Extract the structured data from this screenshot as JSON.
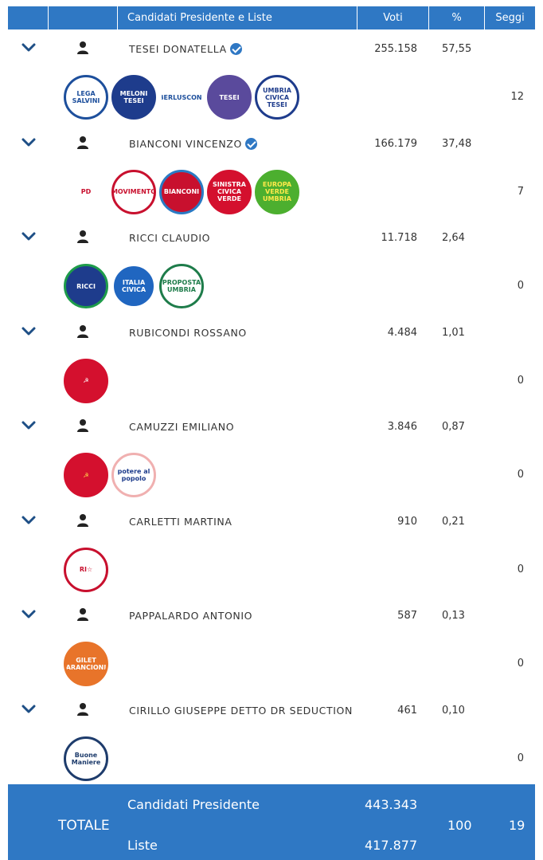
{
  "header": {
    "col_name": "Candidati Presidente e Liste",
    "col_votes": "Voti",
    "col_pct": "%",
    "col_seats": "Seggi"
  },
  "candidates": [
    {
      "name": "TESEI DONATELLA",
      "elected": true,
      "votes": "255.158",
      "pct": "57,55",
      "seats": "12",
      "lists": [
        {
          "icon": "lega-salvini-logo",
          "text": "LEGA SALVINI",
          "bg": "#ffffff",
          "fg": "#1d4f9c",
          "border": "#1d4f9c"
        },
        {
          "icon": "fratelli-italia-logo",
          "text": "MELONI TESEI",
          "bg": "#1e3c8c",
          "fg": "#ffffff",
          "border": "#1e3c8c"
        },
        {
          "icon": "forza-italia-logo",
          "text": "BERLUSCONI",
          "bg": "#ffffff",
          "fg": "#1d4f9c",
          "border": "#ffffff"
        },
        {
          "icon": "tesei-presidente-logo",
          "text": "TESEI",
          "bg": "#5a4a9c",
          "fg": "#ffffff",
          "border": "#5a4a9c"
        },
        {
          "icon": "umbria-civica-logo",
          "text": "UMBRIA CIVICA TESEI",
          "bg": "#ffffff",
          "fg": "#1e3c8c",
          "border": "#1e3c8c"
        }
      ]
    },
    {
      "name": "BIANCONI VINCENZO",
      "elected": true,
      "votes": "166.179",
      "pct": "37,48",
      "seats": "7",
      "lists": [
        {
          "icon": "pd-logo",
          "text": "PD",
          "bg": "#ffffff",
          "fg": "#c8102e",
          "border": "#ffffff"
        },
        {
          "icon": "movimento-5-stelle-logo",
          "text": "MOVIMENTO",
          "bg": "#ffffff",
          "fg": "#c8102e",
          "border": "#c8102e"
        },
        {
          "icon": "bianconi-per-umbria-logo",
          "text": "BIANCONI",
          "bg": "#c8102e",
          "fg": "#ffffff",
          "border": "#2a7ac4"
        },
        {
          "icon": "sinistra-civica-verde-logo",
          "text": "SINISTRA CIVICA VERDE",
          "bg": "#d4102e",
          "fg": "#ffffff",
          "border": "#d4102e"
        },
        {
          "icon": "europa-verde-logo",
          "text": "EUROPA VERDE UMBRIA",
          "bg": "#4caf2f",
          "fg": "#ffe94a",
          "border": "#4caf2f"
        }
      ]
    },
    {
      "name": "RICCI CLAUDIO",
      "elected": false,
      "votes": "11.718",
      "pct": "2,64",
      "seats": "0",
      "lists": [
        {
          "icon": "ricci-presidente-logo",
          "text": "RICCI",
          "bg": "#1e3c8c",
          "fg": "#ffffff",
          "border": "#1e9c4a"
        },
        {
          "icon": "italia-civica-logo",
          "text": "ITALIA CIVICA",
          "bg": "#2066c0",
          "fg": "#ffffff",
          "border": "#ffffff"
        },
        {
          "icon": "proposta-umbria-logo",
          "text": "PROPOSTA UMBRIA",
          "bg": "#ffffff",
          "fg": "#1e7c4a",
          "border": "#1e7c4a"
        }
      ]
    },
    {
      "name": "RUBICONDI ROSSANO",
      "elected": false,
      "votes": "4.484",
      "pct": "1,01",
      "seats": "0",
      "lists": [
        {
          "icon": "partito-comunista-logo",
          "text": "☭",
          "bg": "#d4102e",
          "fg": "#ffffff",
          "border": "#d4102e"
        }
      ]
    },
    {
      "name": "CAMUZZI EMILIANO",
      "elected": false,
      "votes": "3.846",
      "pct": "0,87",
      "seats": "0",
      "lists": [
        {
          "icon": "pci-logo",
          "text": "☭",
          "bg": "#d4102e",
          "fg": "#ffd84a",
          "border": "#d4102e"
        },
        {
          "icon": "potere-al-popolo-logo",
          "text": "potere al popolo",
          "bg": "#ffffff",
          "fg": "#1e3c8c",
          "border": "#f0b0b0"
        }
      ]
    },
    {
      "name": "CARLETTI MARTINA",
      "elected": false,
      "votes": "910",
      "pct": "0,21",
      "seats": "0",
      "lists": [
        {
          "icon": "riconquistare-italia-logo",
          "text": "RI☆",
          "bg": "#ffffff",
          "fg": "#c8102e",
          "border": "#c8102e"
        }
      ]
    },
    {
      "name": "PAPPALARDO ANTONIO",
      "elected": false,
      "votes": "587",
      "pct": "0,13",
      "seats": "0",
      "lists": [
        {
          "icon": "gilet-arancioni-logo",
          "text": "GILET ARANCIONI",
          "bg": "#e8742a",
          "fg": "#ffffff",
          "border": "#e8742a"
        }
      ]
    },
    {
      "name": "CIRILLO GIUSEPPE DETTO DR SEDUCTION",
      "elected": false,
      "votes": "461",
      "pct": "0,10",
      "seats": "0",
      "lists": [
        {
          "icon": "buone-maniere-logo",
          "text": "Buone Maniere",
          "bg": "#ffffff",
          "fg": "#1e3c6c",
          "border": "#1e3c6c"
        }
      ]
    }
  ],
  "total": {
    "label": "TOTALE",
    "cand_label": "Candidati Presidente",
    "lists_label": "Liste",
    "cand_votes": "443.343",
    "lists_votes": "417.877",
    "pct": "100",
    "seats": "19"
  }
}
